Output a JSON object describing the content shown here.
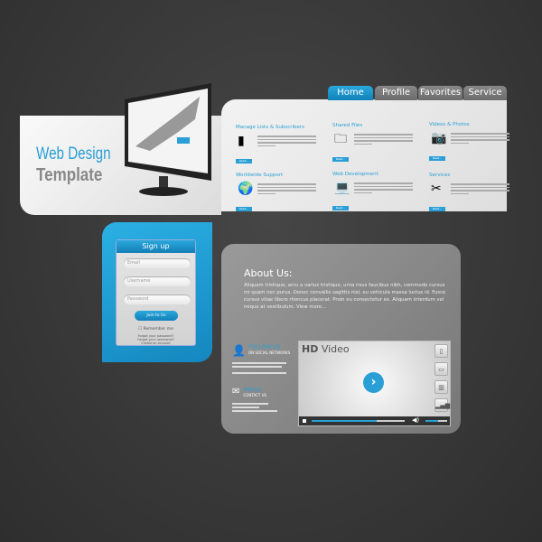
{
  "hero": {
    "title_line1": "Web Design",
    "title_line2": "Template"
  },
  "tabs": [
    {
      "label": "Home",
      "active": true
    },
    {
      "label": "Profile"
    },
    {
      "label": "Favorites"
    },
    {
      "label": "Service"
    }
  ],
  "services": [
    {
      "title": "Manage Lists & Subscribers",
      "icon": "tablet-pen-icon",
      "button": "Read..."
    },
    {
      "title": "Shared Files",
      "icon": "folder-icon",
      "button": "Read..."
    },
    {
      "title": "Videos & Photos",
      "icon": "camera-icon",
      "button": "Read..."
    },
    {
      "title": "Worldwide Support",
      "icon": "globe-magnifier-icon",
      "button": "Read..."
    },
    {
      "title": "Web Development",
      "icon": "laptop-icon",
      "button": "Read..."
    },
    {
      "title": "Services",
      "icon": "tools-icon",
      "button": "Read..."
    }
  ],
  "signup": {
    "title": "Sign up",
    "email_placeholder": "Email",
    "username_placeholder": "Username",
    "password_placeholder": "Password",
    "join": "Join to Us",
    "remember": "Remember me",
    "links": [
      "Forgot your password?",
      "Forgot your username?",
      "Create an account"
    ]
  },
  "about": {
    "title": "About Us:",
    "text": "Aliquam tristique, arcu a varius tristique, urna risus faucibus nibh, commodo cursus mi quam nec purus. Donec convallis sagittis nisl, eu vehicula massa luctus id. Fusce cursus vitae libero rhoncus placerat. Proin eu consectetur ex. Aliquam interdum vel neque at vestibulum. View more..."
  },
  "social": {
    "title": "FOLLOW US",
    "subtitle": "ON SOCIAL NETWORKS"
  },
  "contact": {
    "title": "Adress",
    "subtitle": "CONTACT US"
  },
  "video": {
    "hd": "HD",
    "label": "Video",
    "progress": 0.7,
    "volume": 0.6
  },
  "colors": {
    "accent": "#2a9fd6",
    "background": "#3a3a3a"
  }
}
